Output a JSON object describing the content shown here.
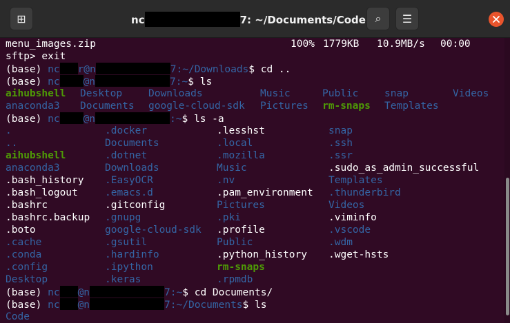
{
  "window": {
    "title_prefix": "nc",
    "title_suffix": "7: ~/Documents/Code",
    "icons": {
      "new_tab": "new-tab-icon",
      "search": "search-icon",
      "menu": "hamburger-menu-icon",
      "close": "close-icon"
    },
    "glyphs": {
      "new_tab": "⊞",
      "search": "⌕",
      "menu": "☰",
      "close": "✕"
    }
  },
  "colors": {
    "background": "#300a24",
    "directory": "#3465a4",
    "highlight_dir": "#4e9a06",
    "text": "#ffffff",
    "close": "#e9542c"
  },
  "terminal": {
    "transfer": {
      "file": "menu_images.zip",
      "percent": "100%",
      "size": "1779KB",
      "rate": "10.9MB/s",
      "eta": "00:00"
    },
    "exit_cmd": "sftp> exit",
    "prompts": {
      "p1": {
        "env": "(base) ",
        "user_a": "nc",
        "user_b": "r@n",
        "host_end": "7",
        "path": ":~/Downloads",
        "cmd": "$ cd .."
      },
      "p2": {
        "env": "(base) ",
        "user_a": "nc",
        "user_b": "@n",
        "host_end": "7",
        "path": ":~",
        "cmd": "$ ls"
      },
      "p3": {
        "env": "(base) ",
        "user_a": "nc",
        "user_b": "@n",
        "host_end": "",
        "path": ":~",
        "cmd": "$ ls -a"
      },
      "p4": {
        "env": "(base) ",
        "user_a": "nc",
        "user_b": "@n",
        "host_end": "7",
        "path": ":~",
        "cmd": "$ cd Documents/"
      },
      "p5": {
        "env": "(base) ",
        "user_a": "nc",
        "user_b": "@n",
        "host_end": "7",
        "path": ":~/Documents",
        "cmd": "$ ls"
      }
    },
    "ls_home": [
      [
        "aihubshell",
        "Desktop",
        "Downloads",
        "Music",
        "Public",
        "snap",
        "Videos"
      ],
      [
        "anaconda3",
        "Documents",
        "google-cloud-sdk",
        "Pictures",
        "rm-snaps",
        "Templates",
        ""
      ]
    ],
    "ls_all": [
      [
        ".",
        ".docker",
        ".lesshst",
        "snap"
      ],
      [
        "..",
        "Documents",
        ".local",
        ".ssh"
      ],
      [
        "aihubshell",
        ".dotnet",
        ".mozilla",
        ".ssr"
      ],
      [
        "anaconda3",
        "Downloads",
        "Music",
        ".sudo_as_admin_successful"
      ],
      [
        ".bash_history",
        ".EasyOCR",
        ".nv",
        "Templates"
      ],
      [
        ".bash_logout",
        ".emacs.d",
        ".pam_environment",
        ".thunderbird"
      ],
      [
        ".bashrc",
        ".gitconfig",
        "Pictures",
        "Videos"
      ],
      [
        ".bashrc.backup",
        ".gnupg",
        ".pki",
        ".viminfo"
      ],
      [
        ".boto",
        "google-cloud-sdk",
        ".profile",
        ".vscode"
      ],
      [
        ".cache",
        ".gsutil",
        "Public",
        ".wdm"
      ],
      [
        ".conda",
        ".hardinfo",
        ".python_history",
        ".wget-hsts"
      ],
      [
        ".config",
        ".ipython",
        "rm-snaps",
        ""
      ],
      [
        "Desktop",
        ".keras",
        ".rpmdb",
        ""
      ]
    ],
    "ls_documents": [
      "Code"
    ]
  }
}
